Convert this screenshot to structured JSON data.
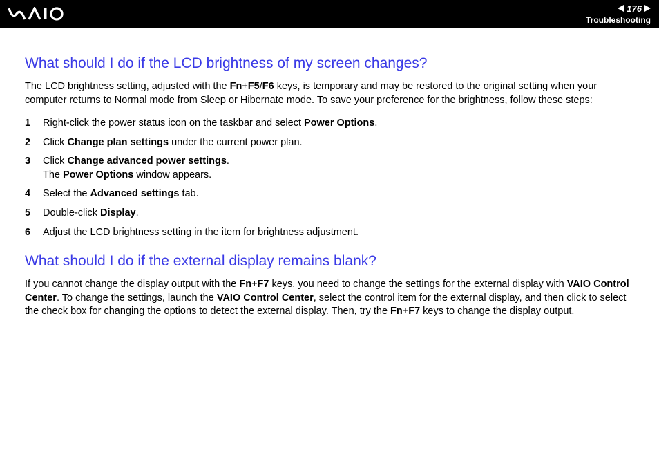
{
  "header": {
    "page_number": "176",
    "section": "Troubleshooting"
  },
  "section1": {
    "heading": "What should I do if the LCD brightness of my screen changes?",
    "intro_pre": "The LCD brightness setting, adjusted with the ",
    "intro_bold1": "Fn",
    "intro_plus1": "+",
    "intro_bold2": "F5",
    "intro_slash": "/",
    "intro_bold3": "F6",
    "intro_post": " keys, is temporary and may be restored to the original setting when your computer returns to Normal mode from Sleep or Hibernate mode. To save your preference for the brightness, follow these steps:",
    "steps": [
      {
        "num": "1",
        "pre": "Right-click the power status icon on the taskbar and select ",
        "b1": "Power Options",
        "post": "."
      },
      {
        "num": "2",
        "pre": "Click ",
        "b1": "Change plan settings",
        "post": " under the current power plan."
      },
      {
        "num": "3",
        "pre": "Click ",
        "b1": "Change advanced power settings",
        "post": ".",
        "line2_pre": "The ",
        "line2_b": "Power Options",
        "line2_post": " window appears."
      },
      {
        "num": "4",
        "pre": "Select the ",
        "b1": "Advanced settings",
        "post": " tab."
      },
      {
        "num": "5",
        "pre": "Double-click ",
        "b1": "Display",
        "post": "."
      },
      {
        "num": "6",
        "pre": "Adjust the LCD brightness setting in the item for brightness adjustment.",
        "b1": "",
        "post": ""
      }
    ]
  },
  "section2": {
    "heading": "What should I do if the external display remains blank?",
    "p_pre": "If you cannot change the display output with the ",
    "p_b1": "Fn",
    "p_plus1": "+",
    "p_b2": "F7",
    "p_mid1": " keys, you need to change the settings for the external display with ",
    "p_b3": "VAIO Control Center",
    "p_mid2": ". To change the settings, launch the ",
    "p_b4": "VAIO Control Center",
    "p_mid3": ", select the control item for the external display, and then click to select the check box for changing the options to detect the external display. Then, try the ",
    "p_b5": "Fn",
    "p_plus2": "+",
    "p_b6": "F7",
    "p_post": " keys to change the display output."
  }
}
